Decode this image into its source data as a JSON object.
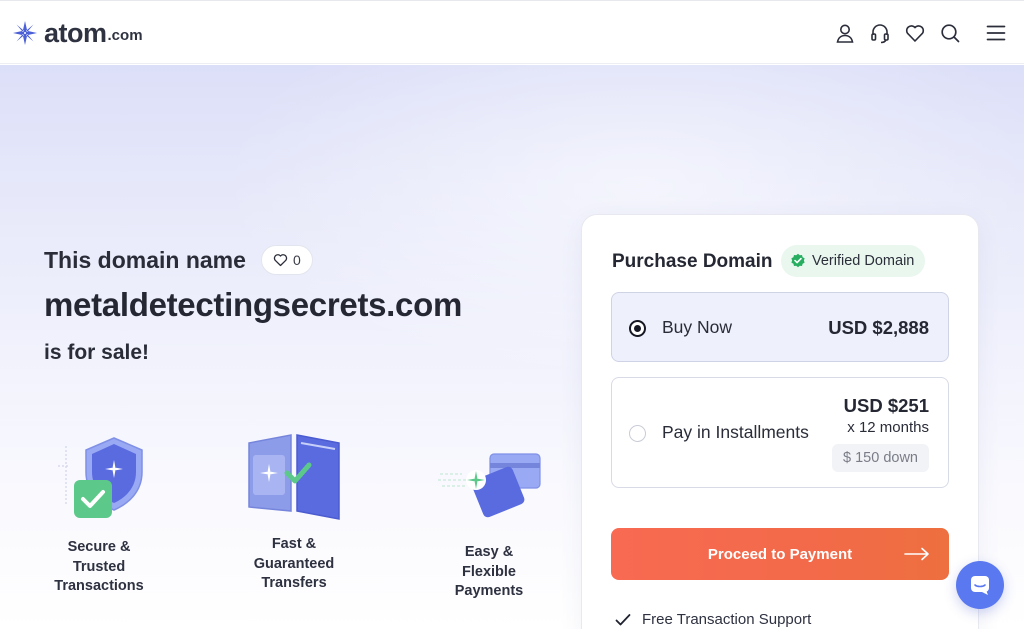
{
  "header": {
    "logo_word": "atom",
    "logo_tld": ".com",
    "icons": [
      "user-icon",
      "headset-icon",
      "heart-icon",
      "search-icon",
      "menu-icon"
    ]
  },
  "hero": {
    "line1": "This domain name",
    "favorites_count": "0",
    "domain": "metaldetectingsecrets.com",
    "line3": "is for sale!"
  },
  "features": [
    {
      "icon": "shield-check-icon",
      "label": "Secure & Trusted Transactions"
    },
    {
      "icon": "transfer-cards-icon",
      "label": "Fast & Guaranteed Transfers"
    },
    {
      "icon": "payment-cards-icon",
      "label": "Easy & Flexible Payments"
    }
  ],
  "purchase": {
    "title": "Purchase Domain",
    "verified_label": "Verified Domain",
    "options": [
      {
        "label": "Buy Now",
        "price": "USD $2,888",
        "selected": true
      },
      {
        "label": "Pay in Installments",
        "price": "USD $251",
        "term": "x 12 months",
        "down": "$ 150 down",
        "selected": false
      }
    ],
    "proceed_label": "Proceed to Payment",
    "support_label": "Free Transaction Support"
  },
  "colors": {
    "accent": "#f26a4b",
    "brand": "#4b5fd6",
    "verified": "#27ae60",
    "chat": "#5a78f0"
  }
}
